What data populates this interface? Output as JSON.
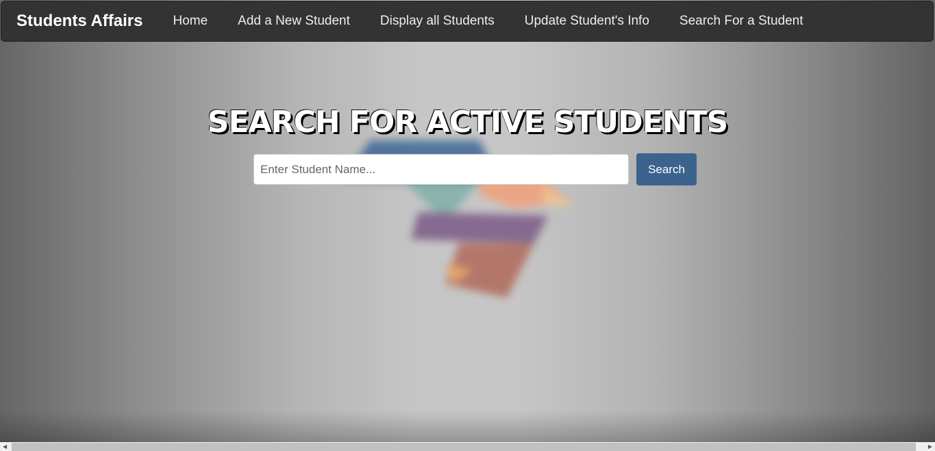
{
  "navbar": {
    "brand": "Students Affairs",
    "links": [
      "Home",
      "Add a New Student",
      "Display all Students",
      "Update Student's Info",
      "Search For a Student"
    ]
  },
  "main": {
    "title": "SEARCH FOR ACTIVE STUDENTS",
    "search_placeholder": "Enter Student Name...",
    "search_value": "",
    "search_button": "Search"
  },
  "colors": {
    "navbar": "#333333",
    "button": "#3b638e"
  }
}
